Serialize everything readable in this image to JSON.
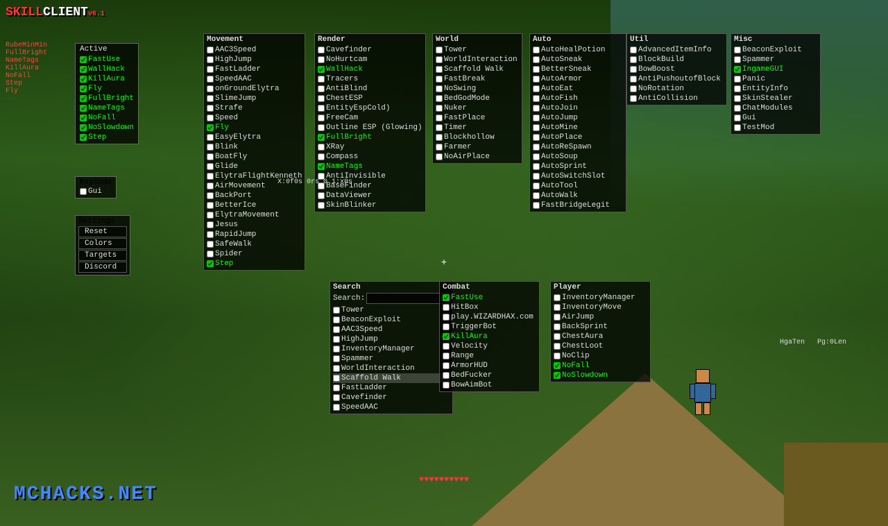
{
  "app": {
    "title": "SKILLCLIENT",
    "version": "v6.1",
    "watermark": "MCHACKS.NET"
  },
  "sidebar": {
    "categories": [
      "RubeMinMin",
      "FullBright",
      "NameTags",
      "KillAura",
      "NoFall",
      "Step",
      "Fly"
    ],
    "active_label": "Active",
    "active_items": [
      "FastUse",
      "WallHack",
      "KillAura",
      "Fly",
      "FullBright",
      "NameTags",
      "NoFall",
      "NoSlowdown",
      "Step"
    ]
  },
  "keycode": {
    "title": "Keycode",
    "items": [
      "Gui"
    ]
  },
  "settings": {
    "title": "Settings",
    "buttons": [
      "Reset",
      "Colors",
      "Targets",
      "Discord"
    ]
  },
  "panels": {
    "movement": {
      "title": "Movement",
      "items": [
        {
          "label": "AAC3Speed",
          "checked": false
        },
        {
          "label": "HighJump",
          "checked": false
        },
        {
          "label": "FastLadder",
          "checked": false
        },
        {
          "label": "SpeedAAC",
          "checked": false
        },
        {
          "label": "onGroundElytra",
          "checked": false
        },
        {
          "label": "SlimeJump",
          "checked": false
        },
        {
          "label": "Strafe",
          "checked": false
        },
        {
          "label": "Speed",
          "checked": false
        },
        {
          "label": "Fly",
          "checked": true
        },
        {
          "label": "EasyElytra",
          "checked": false
        },
        {
          "label": "Blink",
          "checked": false
        },
        {
          "label": "BoatFly",
          "checked": false
        },
        {
          "label": "Glide",
          "checked": false
        },
        {
          "label": "ElytraFlightKenneth",
          "checked": false
        },
        {
          "label": "AirMovement",
          "checked": false
        },
        {
          "label": "BackPort",
          "checked": false
        },
        {
          "label": "BetterIce",
          "checked": false
        },
        {
          "label": "ElytraMovement",
          "checked": false
        },
        {
          "label": "Jesus",
          "checked": false
        },
        {
          "label": "RapidJump",
          "checked": false
        },
        {
          "label": "SafeWalk",
          "checked": false
        },
        {
          "label": "Spider",
          "checked": false
        },
        {
          "label": "Step",
          "checked": true
        }
      ]
    },
    "render": {
      "title": "Render",
      "items": [
        {
          "label": "Cavefinder",
          "checked": false
        },
        {
          "label": "NoHurtcam",
          "checked": false
        },
        {
          "label": "WallHack",
          "checked": true
        },
        {
          "label": "Tracers",
          "checked": false
        },
        {
          "label": "AntiBlind",
          "checked": false
        },
        {
          "label": "ChestESP",
          "checked": false
        },
        {
          "label": "EntityEspCold)",
          "checked": false
        },
        {
          "label": "FreeCam",
          "checked": false
        },
        {
          "label": "Outline ESP (Glowing)",
          "checked": false
        },
        {
          "label": "FullBright",
          "checked": true
        },
        {
          "label": "XRay",
          "checked": false
        },
        {
          "label": "Compass",
          "checked": false
        },
        {
          "label": "NameTags",
          "checked": true
        },
        {
          "label": "AntiInvisible",
          "checked": false
        },
        {
          "label": "BaseFinder",
          "checked": false
        },
        {
          "label": "DataViewer",
          "checked": false
        },
        {
          "label": "SkinBlinker",
          "checked": false
        }
      ]
    },
    "world": {
      "title": "World",
      "items": [
        {
          "label": "Tower",
          "checked": false
        },
        {
          "label": "WorldInteraction",
          "checked": false
        },
        {
          "label": "Scaffold Walk",
          "checked": false
        },
        {
          "label": "FastBreak",
          "checked": false
        },
        {
          "label": "NoSwing",
          "checked": false
        },
        {
          "label": "BedGodMode",
          "checked": false
        },
        {
          "label": "Nuker",
          "checked": false
        },
        {
          "label": "FastPlace",
          "checked": false
        },
        {
          "label": "Timer",
          "checked": false
        },
        {
          "label": "Blockhollow",
          "checked": false
        },
        {
          "label": "Farmer",
          "checked": false
        },
        {
          "label": "NoAirPlace",
          "checked": false
        }
      ]
    },
    "auto": {
      "title": "Auto",
      "items": [
        {
          "label": "AutoHealPotion",
          "checked": false
        },
        {
          "label": "AutoSneak",
          "checked": false
        },
        {
          "label": "BetterSneak",
          "checked": false
        },
        {
          "label": "AutoArmor",
          "checked": false
        },
        {
          "label": "AutoEat",
          "checked": false
        },
        {
          "label": "AutoFish",
          "checked": false
        },
        {
          "label": "AutoJoin",
          "checked": false
        },
        {
          "label": "AutoJump",
          "checked": false
        },
        {
          "label": "AutoMine",
          "checked": false
        },
        {
          "label": "AutoPlace",
          "checked": false
        },
        {
          "label": "AutoReSpawn",
          "checked": false
        },
        {
          "label": "AutoSoup",
          "checked": false
        },
        {
          "label": "AutoSprint",
          "checked": false
        },
        {
          "label": "AutoSwitchSlot",
          "checked": false
        },
        {
          "label": "AutoTool",
          "checked": false
        },
        {
          "label": "AutoWalk",
          "checked": false
        },
        {
          "label": "FastBridgeLegit",
          "checked": false
        }
      ]
    },
    "util": {
      "title": "Util",
      "items": [
        {
          "label": "AdvancedItemInfo",
          "checked": false
        },
        {
          "label": "BlockBuild",
          "checked": false
        },
        {
          "label": "BowBoost",
          "checked": false
        },
        {
          "label": "AntiPushoutofBlock",
          "checked": false
        },
        {
          "label": "NoRotation",
          "checked": false
        },
        {
          "label": "AntiCollision",
          "checked": false
        }
      ]
    },
    "misc": {
      "title": "Misc",
      "items": [
        {
          "label": "BeaconExploit",
          "checked": false
        },
        {
          "label": "Spammer",
          "checked": false
        },
        {
          "label": "IngameGUI",
          "checked": true
        },
        {
          "label": "Panic",
          "checked": false
        },
        {
          "label": "EntityInfo",
          "checked": false
        },
        {
          "label": "SkinStealer",
          "checked": false
        },
        {
          "label": "ChatModules",
          "checked": false
        },
        {
          "label": "Gui",
          "checked": false
        },
        {
          "label": "TestMod",
          "checked": false
        }
      ]
    },
    "search": {
      "title": "Search",
      "search_label": "Search:",
      "search_value": "",
      "search_placeholder": "",
      "items": [
        {
          "label": "Tower",
          "checked": false,
          "highlight": false
        },
        {
          "label": "BeaconExploit",
          "checked": false,
          "highlight": false
        },
        {
          "label": "AAC3Speed",
          "checked": false,
          "highlight": false
        },
        {
          "label": "HighJump",
          "checked": false,
          "highlight": false
        },
        {
          "label": "InventoryManager",
          "checked": false,
          "highlight": false
        },
        {
          "label": "Spammer",
          "checked": false,
          "highlight": false
        },
        {
          "label": "WorldInteraction",
          "checked": false,
          "highlight": false
        },
        {
          "label": "Scaffold Walk",
          "checked": false,
          "highlight": true
        },
        {
          "label": "FastLadder",
          "checked": false,
          "highlight": false
        },
        {
          "label": "Cavefinder",
          "checked": false,
          "highlight": false
        },
        {
          "label": "SpeedAAC",
          "checked": false,
          "highlight": false
        }
      ]
    },
    "combat": {
      "title": "Combat",
      "items": [
        {
          "label": "FastUse",
          "checked": true
        },
        {
          "label": "HitBox",
          "checked": false
        },
        {
          "label": "play.WIZARDHAX.com",
          "checked": false
        },
        {
          "label": "TriggerBot",
          "checked": false
        },
        {
          "label": "KillAura",
          "checked": true
        },
        {
          "label": "Velocity",
          "checked": false
        },
        {
          "label": "Range",
          "checked": false
        },
        {
          "label": "ArmorHUD",
          "checked": false
        },
        {
          "label": "BedFucker",
          "checked": false
        },
        {
          "label": "BowAimBot",
          "checked": false
        }
      ]
    },
    "player": {
      "title": "Player",
      "items": [
        {
          "label": "InventoryManager",
          "checked": false
        },
        {
          "label": "InventoryMove",
          "checked": false
        },
        {
          "label": "AirJump",
          "checked": false
        },
        {
          "label": "BackSprint",
          "checked": false
        },
        {
          "label": "ChestAura",
          "checked": false
        },
        {
          "label": "ChestLoot",
          "checked": false
        },
        {
          "label": "NoClip",
          "checked": false
        },
        {
          "label": "NoFall",
          "checked": true
        },
        {
          "label": "NoSlowdown",
          "checked": true
        }
      ]
    }
  },
  "hud": {
    "crosshair": "+",
    "hearts": "♥♥♥♥♥♥♥♥♥♥"
  }
}
